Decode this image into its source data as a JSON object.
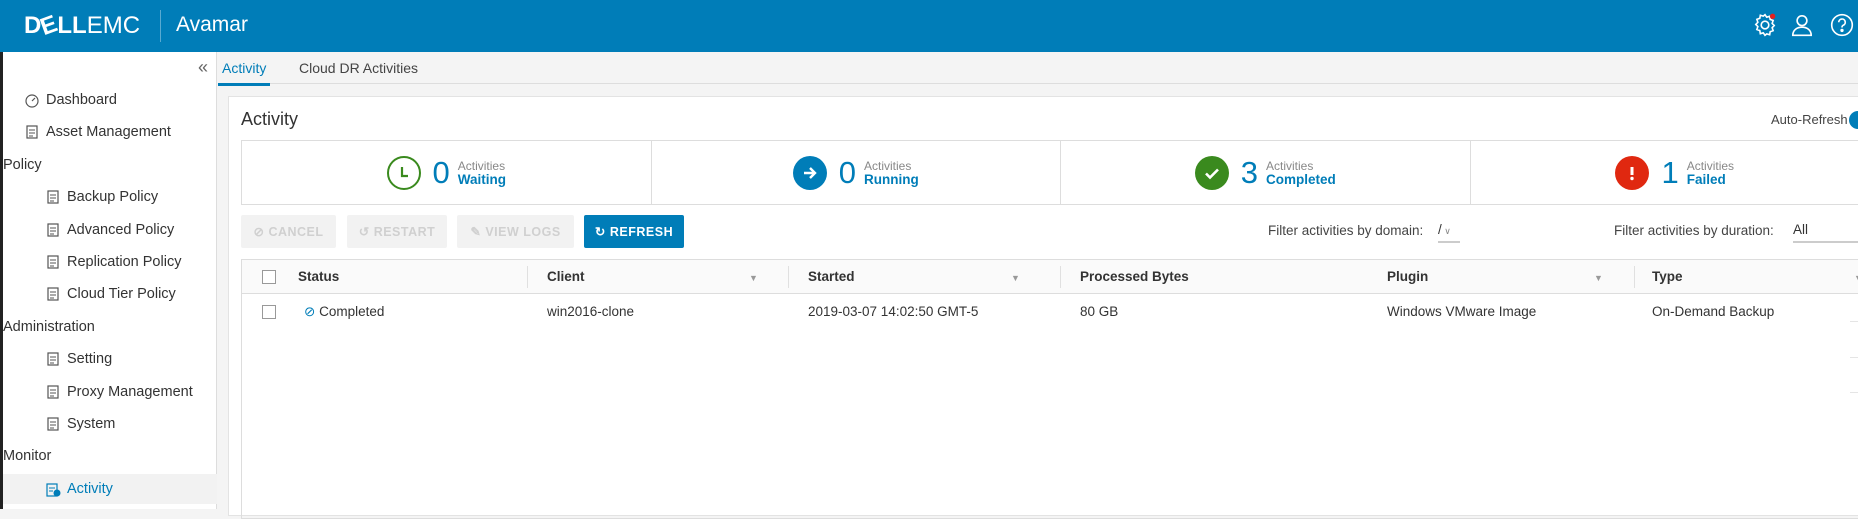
{
  "header": {
    "brand": "DELLEMC",
    "brand_bold": "D&LL",
    "brand_light": "EMC",
    "app": "Avamar",
    "icons": [
      "gear-icon",
      "user-icon",
      "help-icon"
    ],
    "accent": "#007db8",
    "notification_dot": "#e02020"
  },
  "sidebar": {
    "collapse_icon": "double-chevron-left",
    "items": [
      {
        "label": "Dashboard",
        "kind": "top",
        "icon": "gauge-icon"
      },
      {
        "label": "Asset Management",
        "kind": "top",
        "icon": "asset-icon"
      },
      {
        "label": "Policy",
        "kind": "section"
      },
      {
        "label": "Backup Policy",
        "kind": "sub",
        "icon": "backup-policy-icon"
      },
      {
        "label": "Advanced Policy",
        "kind": "sub",
        "icon": "advanced-policy-icon"
      },
      {
        "label": "Replication Policy",
        "kind": "sub",
        "icon": "replication-icon"
      },
      {
        "label": "Cloud Tier Policy",
        "kind": "sub",
        "icon": "cloud-icon"
      },
      {
        "label": "Administration",
        "kind": "section"
      },
      {
        "label": "Setting",
        "kind": "sub",
        "icon": "setting-icon"
      },
      {
        "label": "Proxy Management",
        "kind": "sub",
        "icon": "proxy-icon"
      },
      {
        "label": "System",
        "kind": "sub",
        "icon": "system-icon"
      },
      {
        "label": "Monitor",
        "kind": "section"
      },
      {
        "label": "Activity",
        "kind": "sub",
        "icon": "activity-icon",
        "active": true
      }
    ]
  },
  "tabs": [
    {
      "label": "Activity",
      "active": true
    },
    {
      "label": "Cloud DR Activities"
    }
  ],
  "panel": {
    "title": "Activity",
    "auto_refresh": "Auto-Refresh",
    "summary": [
      {
        "count": "0",
        "line1": "Activities",
        "line2": "Waiting",
        "icon": "clock-icon",
        "color": "#3a8a1e"
      },
      {
        "count": "0",
        "line1": "Activities",
        "line2": "Running",
        "icon": "arrow-right-icon",
        "color": "#007db8"
      },
      {
        "count": "3",
        "line1": "Activities",
        "line2": "Completed",
        "icon": "check-icon",
        "color": "#3a8a1e"
      },
      {
        "count": "1",
        "line1": "Activities",
        "line2": "Failed",
        "icon": "exclamation-icon",
        "color": "#e02810"
      }
    ],
    "buttons": {
      "cancel": "CANCEL",
      "restart": "RESTART",
      "view_logs": "VIEW LOGS",
      "refresh": "REFRESH"
    },
    "filter_domain_label": "Filter activities by domain:",
    "filter_domain_value": "/",
    "filter_duration_label": "Filter activities by duration:",
    "filter_duration_value": "All"
  },
  "table": {
    "columns": [
      "Status",
      "Client",
      "Started",
      "Processed Bytes",
      "Plugin",
      "Type"
    ],
    "rows": [
      {
        "status": "Completed",
        "client": "win2016-clone",
        "started": "2019-03-07 14:02:50 GMT-5",
        "processed": "80 GB",
        "plugin": "Windows VMware Image",
        "type": "On-Demand Backup"
      }
    ]
  }
}
